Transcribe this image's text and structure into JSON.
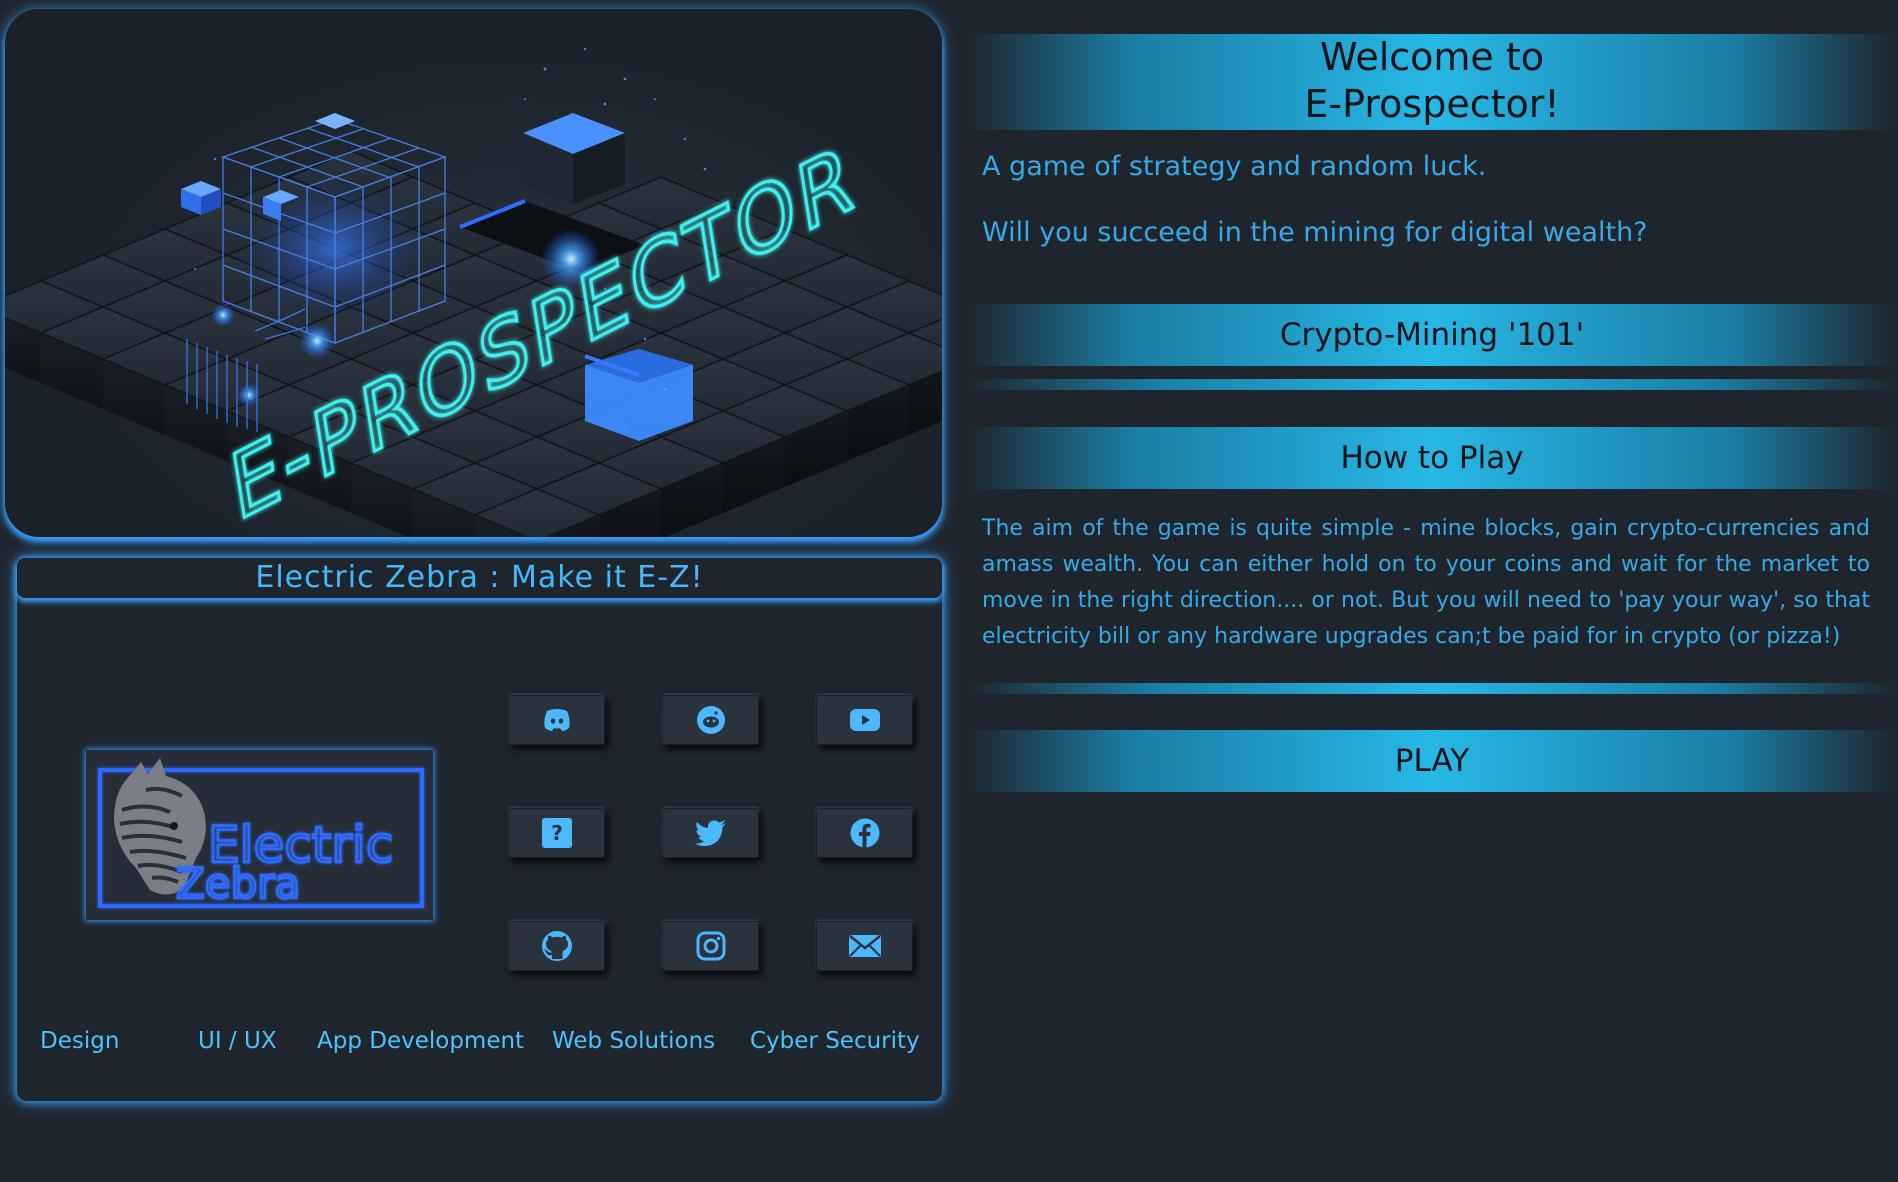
{
  "hero": {
    "logo_text": "E-PROSPECTOR"
  },
  "brand": {
    "tagline": "Electric Zebra : Make it E-Z!",
    "logo_text_line1": "Electric",
    "logo_text_line2": "Zebra",
    "social_buttons": [
      {
        "name": "discord",
        "icon": "discord-icon"
      },
      {
        "name": "reddit",
        "icon": "reddit-icon"
      },
      {
        "name": "youtube",
        "icon": "youtube-icon"
      },
      {
        "name": "help",
        "icon": "question-icon"
      },
      {
        "name": "twitter",
        "icon": "twitter-icon"
      },
      {
        "name": "facebook",
        "icon": "facebook-icon"
      },
      {
        "name": "github",
        "icon": "github-icon"
      },
      {
        "name": "instagram",
        "icon": "instagram-icon"
      },
      {
        "name": "email",
        "icon": "envelope-icon"
      }
    ],
    "services": [
      "Design",
      "UI / UX",
      "App Development",
      "Web Solutions",
      "Cyber Security"
    ]
  },
  "main": {
    "welcome_line1": "Welcome to",
    "welcome_line2": "E-Prospector!",
    "intro1": "A game of strategy and random luck.",
    "intro2": "Will you succeed in the mining for digital wealth?",
    "crypto_title": "Crypto-Mining '101'",
    "how_title": "How to Play",
    "how_text": "The aim of the game is quite simple - mine blocks, gain crypto-currencies and amass wealth. You can either hold on to your coins and wait for the market to move in the right direction.... or not. But you will need to 'pay your way', so that electricity bill or any hardware upgrades can;t be paid for in crypto (or pizza!)",
    "play_label": "PLAY"
  },
  "colors": {
    "background": "#1f252d",
    "accent_glow": "#3aa0ff",
    "text_blue": "#36a9e6",
    "banner_cyan": "#27b8e6",
    "hero_text": "#3ff0ee"
  }
}
